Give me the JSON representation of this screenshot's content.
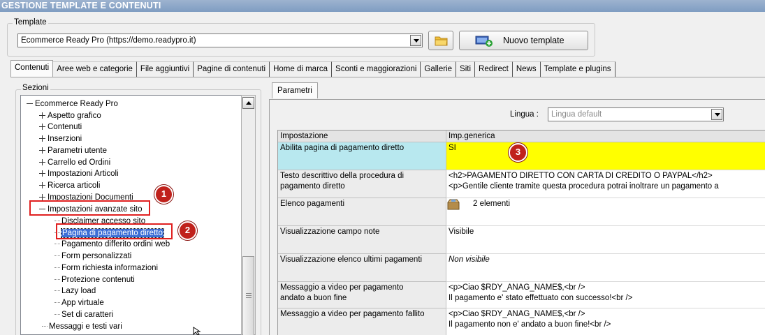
{
  "window": {
    "title": "GESTIONE TEMPLATE E CONTENUTI"
  },
  "template_group": {
    "label": "Template",
    "selected": "Ecommerce Ready Pro (https://demo.readypro.it)",
    "new_button": "Nuovo template"
  },
  "tabs": [
    "Contenuti",
    "Aree web e categorie",
    "File aggiuntivi",
    "Pagine di contenuti",
    "Home di marca",
    "Sconti e maggiorazioni",
    "Gallerie",
    "Siti",
    "Redirect",
    "News",
    "Template e plugins"
  ],
  "sections": {
    "label": "Sezioni",
    "root": "Ecommerce Ready Pro",
    "items": [
      "Aspetto grafico",
      "Contenuti",
      "Inserzioni",
      "Parametri utente",
      "Carrello ed Ordini",
      "Impostazioni Articoli",
      "Ricerca articoli",
      "Impostazioni Documenti",
      "Impostazioni avanzate sito"
    ],
    "children": [
      "Disclaimer accesso sito",
      "Pagina di pagamento diretto",
      "Pagamento differito ordini web",
      "Form personalizzati",
      "Form richiesta informazioni",
      "Protezione contenuti",
      "Lazy load",
      "App virtuale",
      "Set di caratteri"
    ],
    "after": "Messaggi e testi vari"
  },
  "params": {
    "tab": "Parametri",
    "lingua_label": "Lingua :",
    "lingua_value": "Lingua default",
    "header": [
      "Impostazione",
      "Imp.generica"
    ],
    "rows": [
      {
        "name": "Abilita pagina di pagamento diretto",
        "value": "SI"
      },
      {
        "name": "Testo descrittivo della procedura di",
        "name2": "pagamento diretto",
        "value": "<h2>PAGAMENTO DIRETTO CON CARTA DI CREDITO O PAYPAL</h2>",
        "value2": "<p>Gentile cliente tramite questa procedura potrai inoltrare un pagamento a"
      },
      {
        "name": "Elenco pagamenti",
        "value": "2 elementi"
      },
      {
        "name": "Visualizzazione campo note",
        "value": "Visibile"
      },
      {
        "name": "Visualizzazione elenco  ultimi pagamenti",
        "value": "Non visibile"
      },
      {
        "name": "Messaggio a video per pagamento",
        "name2": "andato a buon fine",
        "value": "<p>Ciao $RDY_ANAG_NAME$,<br />",
        "value2": "Il pagamento e' stato effettuato con successo!<br />"
      },
      {
        "name": "Messaggio a video per pagamento fallito",
        "value": "<p>Ciao $RDY_ANAG_NAME$,<br />",
        "value2": "Il pagamento non e' andato a buon fine!<br />"
      }
    ]
  },
  "badges": [
    "1",
    "2",
    "3"
  ],
  "colors": {
    "highlight_yellow": "#ffff00",
    "highlight_cyan": "#b8e8ef",
    "annotation_red": "#e02020"
  }
}
